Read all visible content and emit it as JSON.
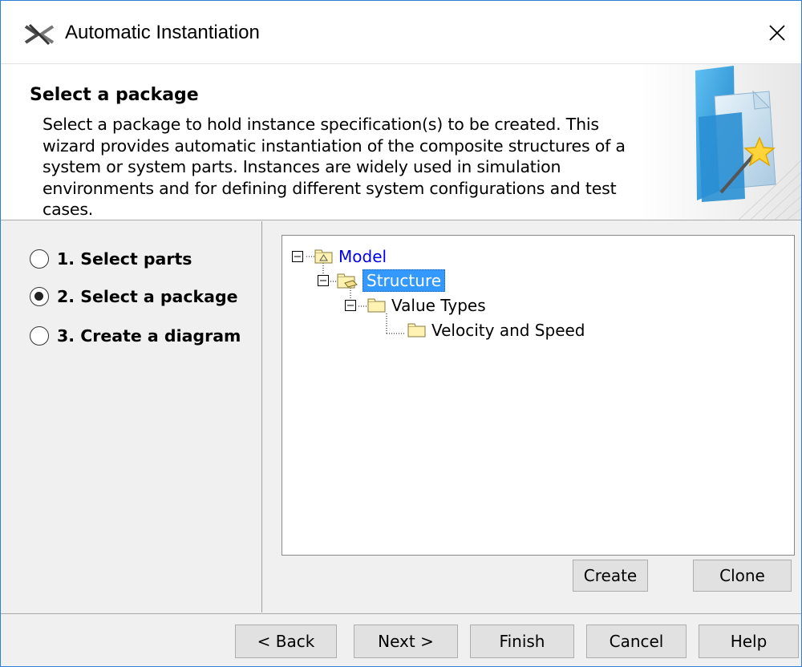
{
  "window": {
    "title": "Automatic Instantiation",
    "close_glyph": "✕"
  },
  "header": {
    "title": "Select a package",
    "description": "Select a package to hold instance specification(s) to be created. This wizard provides automatic instantiation of the composite structures of a system or system parts. Instances are widely used in simulation environments and for defining different system configurations and test cases.",
    "art_icon": "folder-magic-wand-icon"
  },
  "steps": [
    {
      "label": "1. Select parts",
      "checked": false
    },
    {
      "label": "2. Select a package",
      "checked": true
    },
    {
      "label": "3. Create a diagram",
      "checked": false
    }
  ],
  "tree": {
    "nodes": [
      {
        "label": "Model",
        "icon": "model-package-icon",
        "style": "link",
        "expander": "minus"
      },
      {
        "label": "Structure",
        "icon": "package-icon",
        "style": "selected",
        "expander": "minus"
      },
      {
        "label": "Value Types",
        "icon": "folder-icon",
        "style": "normal",
        "expander": "minus"
      },
      {
        "label": "Velocity and Speed",
        "icon": "folder-icon",
        "style": "normal",
        "expander": "none"
      }
    ]
  },
  "panel_buttons": {
    "create": "Create",
    "clone": "Clone"
  },
  "footer_buttons": {
    "back": "< Back",
    "next": "Next >",
    "finish": "Finish",
    "cancel": "Cancel",
    "help": "Help"
  },
  "colors": {
    "selection": "#3399ff",
    "link": "#0000ee",
    "window_border": "#2b7fd6"
  }
}
